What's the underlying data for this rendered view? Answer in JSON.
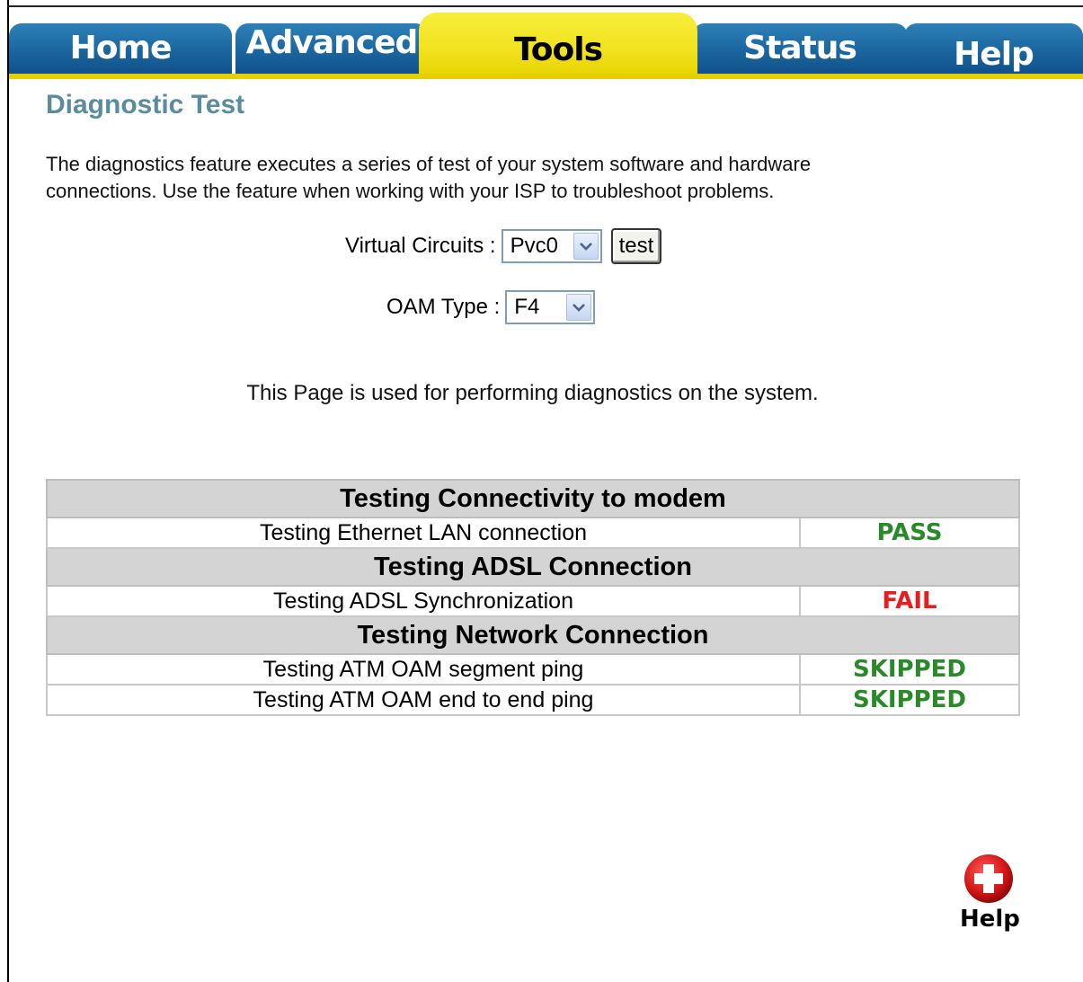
{
  "tabs": [
    {
      "label": "Home",
      "active": false
    },
    {
      "label": "Advanced",
      "active": false
    },
    {
      "label": "Tools",
      "active": true
    },
    {
      "label": "Status",
      "active": false
    },
    {
      "label": "Help",
      "active": false
    }
  ],
  "page": {
    "title": "Diagnostic Test",
    "intro": "The diagnostics feature executes a series of test of your system software and hardware connections. Use the feature when working with your ISP to troubleshoot problems.",
    "description": "This Page is used for performing diagnostics on the system."
  },
  "form": {
    "vc_label": "Virtual Circuits :",
    "vc_value": "Pvc0",
    "test_label": "test",
    "oam_label": "OAM Type :",
    "oam_value": "F4"
  },
  "results": {
    "sections": [
      {
        "heading": "Testing Connectivity to modem",
        "tests": [
          {
            "name": "Testing Ethernet LAN connection",
            "status": "PASS"
          }
        ]
      },
      {
        "heading": "Testing ADSL Connection",
        "tests": [
          {
            "name": "Testing ADSL Synchronization",
            "status": "FAIL"
          }
        ]
      },
      {
        "heading": "Testing Network Connection",
        "tests": [
          {
            "name": "Testing ATM OAM segment ping",
            "status": "SKIPPED"
          },
          {
            "name": "Testing ATM OAM end to end ping",
            "status": "SKIPPED"
          }
        ]
      }
    ]
  },
  "help": {
    "label": "Help",
    "icon": "help-plus-icon"
  },
  "colors": {
    "pass": "#2a8a2a",
    "fail": "#e51f1f",
    "skipped": "#2a8a2a",
    "tab_active": "#f1e21e",
    "tab": "#1e6aa3",
    "title": "#5b8c9e"
  }
}
